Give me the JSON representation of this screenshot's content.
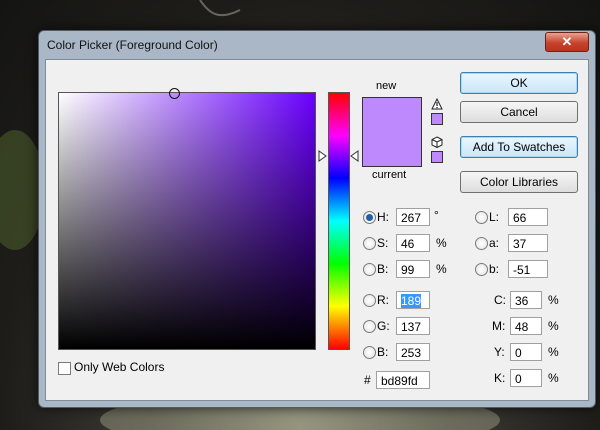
{
  "dialog": {
    "title": "Color Picker (Foreground Color)",
    "close_label": "✕"
  },
  "colors": {
    "new": "#bd89fd",
    "current": "#bd89fd",
    "hue_pure": "#6a00ff"
  },
  "swatch_labels": {
    "new": "new",
    "current": "current"
  },
  "buttons": {
    "ok": "OK",
    "cancel": "Cancel",
    "add_to_swatches": "Add To Swatches",
    "color_libraries": "Color Libraries"
  },
  "hsb": {
    "h": {
      "label": "H:",
      "value": "267",
      "unit": "°"
    },
    "s": {
      "label": "S:",
      "value": "46",
      "unit": "%"
    },
    "b": {
      "label": "B:",
      "value": "99",
      "unit": "%"
    }
  },
  "rgb": {
    "r": {
      "label": "R:",
      "value": "189"
    },
    "g": {
      "label": "G:",
      "value": "137"
    },
    "b": {
      "label": "B:",
      "value": "253"
    }
  },
  "lab": {
    "l": {
      "label": "L:",
      "value": "66"
    },
    "a": {
      "label": "a:",
      "value": "37"
    },
    "b": {
      "label": "b:",
      "value": "-51"
    }
  },
  "cmyk": {
    "c": {
      "label": "C:",
      "value": "36",
      "unit": "%"
    },
    "m": {
      "label": "M:",
      "value": "48",
      "unit": "%"
    },
    "y": {
      "label": "Y:",
      "value": "0",
      "unit": "%"
    },
    "k": {
      "label": "K:",
      "value": "0",
      "unit": "%"
    }
  },
  "hex": {
    "label": "#",
    "value": "bd89fd"
  },
  "only_web_colors": {
    "label": "Only Web Colors",
    "checked": false
  }
}
